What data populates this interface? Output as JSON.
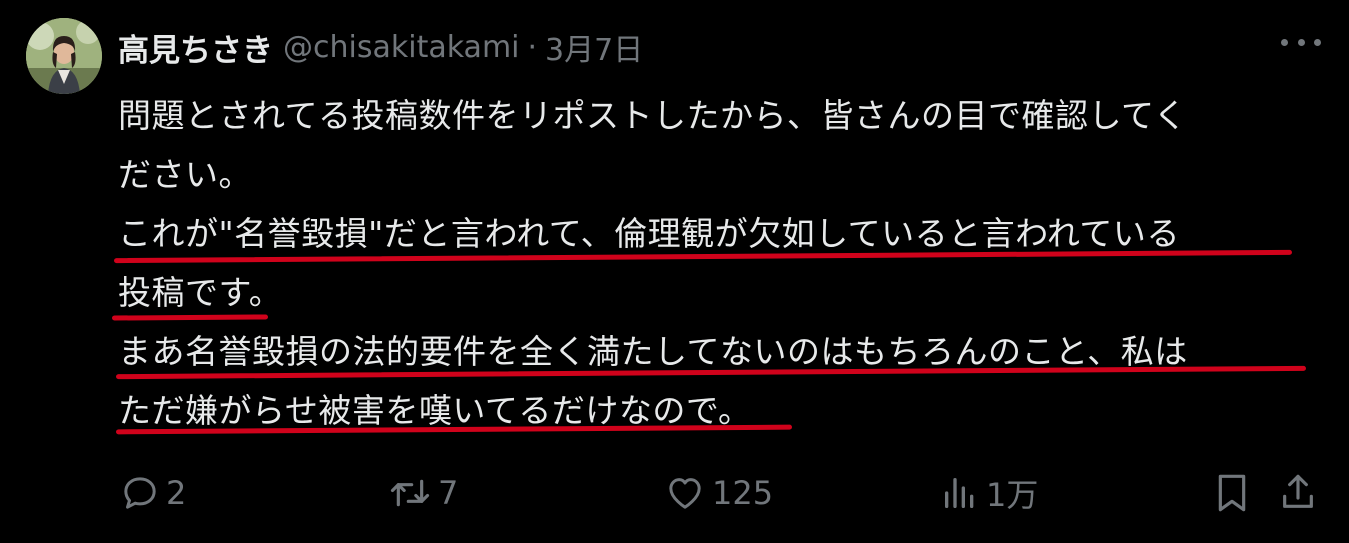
{
  "tweet": {
    "author": {
      "name": "高見ちさき",
      "handle": "@chisakitakami",
      "separator": "·",
      "date": "3月7日"
    },
    "lines": [
      "問題とされてる投稿数件をリポストしたから、皆さんの目で確認してく",
      "ださい。",
      "これが\"名誉毀損\"だと言われて、倫理観が欠如していると言われている",
      "投稿です。",
      "まあ名誉毀損の法的要件を全く満たしてないのはもちろんのこと、私は",
      "ただ嫌がらせ被害を嘆いてるだけなので。"
    ],
    "actions": {
      "reply_count": "2",
      "repost_count": "7",
      "like_count": "125",
      "views_count": "1万"
    }
  },
  "colors": {
    "background": "#000000",
    "text": "#e7e9ea",
    "muted": "#71767b",
    "underline": "#d0021b"
  },
  "icons": [
    "more-icon",
    "reply-icon",
    "repost-icon",
    "like-icon",
    "views-icon",
    "bookmark-icon",
    "share-icon"
  ]
}
